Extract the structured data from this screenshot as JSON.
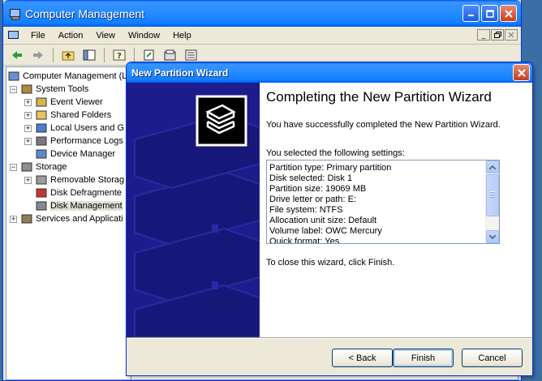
{
  "main_window": {
    "title": "Computer Management",
    "menu": [
      "File",
      "Action",
      "View",
      "Window",
      "Help"
    ],
    "tree": [
      {
        "label": "Computer Management (L",
        "level": 0,
        "expander": "",
        "icon": "computer-icon"
      },
      {
        "label": "System Tools",
        "level": 1,
        "expander": "−",
        "icon": "tools-icon"
      },
      {
        "label": "Event Viewer",
        "level": 2,
        "expander": "+",
        "icon": "event-viewer-icon"
      },
      {
        "label": "Shared Folders",
        "level": 2,
        "expander": "+",
        "icon": "shared-folder-icon"
      },
      {
        "label": "Local Users and G",
        "level": 2,
        "expander": "+",
        "icon": "users-icon"
      },
      {
        "label": "Performance Logs",
        "level": 2,
        "expander": "+",
        "icon": "performance-icon"
      },
      {
        "label": "Device Manager",
        "level": 2,
        "expander": "",
        "icon": "device-manager-icon"
      },
      {
        "label": "Storage",
        "level": 1,
        "expander": "−",
        "icon": "storage-icon"
      },
      {
        "label": "Removable Storag",
        "level": 2,
        "expander": "+",
        "icon": "removable-storage-icon"
      },
      {
        "label": "Disk Defragmente",
        "level": 2,
        "expander": "",
        "icon": "defrag-icon"
      },
      {
        "label": "Disk Management",
        "level": 2,
        "expander": "",
        "icon": "disk-management-icon",
        "selected": true
      },
      {
        "label": "Services and Applicati",
        "level": 1,
        "expander": "+",
        "icon": "services-icon"
      }
    ]
  },
  "wizard": {
    "title": "New Partition Wizard",
    "heading": "Completing the New Partition Wizard",
    "success_text": "You have successfully completed the New Partition Wizard.",
    "settings_label": "You selected the following settings:",
    "settings": [
      "Partition type: Primary partition",
      "Disk selected: Disk 1",
      "Partition size: 19069 MB",
      "Drive letter or path: E:",
      "File system: NTFS",
      "Allocation unit size: Default",
      "Volume label: OWC Mercury",
      "Quick format: Yes"
    ],
    "close_text": "To close this wizard, click Finish.",
    "buttons": {
      "back": "< Back",
      "finish": "Finish",
      "cancel": "Cancel"
    },
    "close_glyph": "✕"
  },
  "colors": {
    "sidebar_bg": "#1c1c8c",
    "titlebar_blue": "#0058e6"
  }
}
